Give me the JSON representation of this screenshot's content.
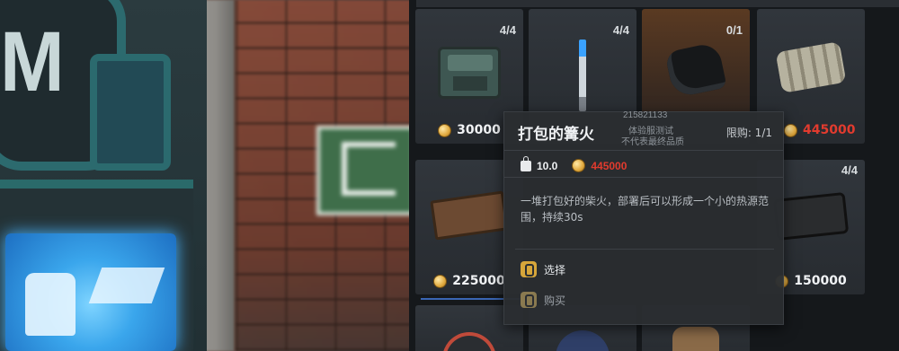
{
  "shop": {
    "top_text": "... ...",
    "items": [
      {
        "stock": "4/4",
        "price": "30000",
        "price_color": "#f1f3f5",
        "icon": "medical-bag-icon"
      },
      {
        "stock": "4/4",
        "price": "",
        "price_color": "#f1f3f5",
        "icon": "syringe-icon"
      },
      {
        "stock": "0/1",
        "price": "",
        "price_color": "#f1f3f5",
        "icon": "coal-icon"
      },
      {
        "stock": "",
        "price": "445000",
        "price_color": "#e23b2e",
        "icon": "firewood-bundle-icon"
      },
      {
        "stock": "",
        "price": "225000",
        "price_color": "#f1f3f5",
        "icon": "ammo-crate-icon"
      },
      {
        "stock": "4/4",
        "price": "150000",
        "price_color": "#f1f3f5",
        "icon": "hard-case-icon"
      }
    ]
  },
  "tooltip": {
    "title": "打包的篝火",
    "watermark_id": "215821133",
    "watermark_line1": "体验服测试",
    "watermark_line2": "不代表最终品质",
    "limit": "限购: 1/1",
    "weight": "10.0",
    "price": "445000",
    "description": "一堆打包好的柴火，部署后可以形成一个小的热源范围，持续30s",
    "action_select": "选择",
    "action_buy": "购买"
  },
  "colors": {
    "accent_red": "#e23b2e",
    "selected_card": "#5a3a22",
    "key_gold": "#d7a63a"
  }
}
